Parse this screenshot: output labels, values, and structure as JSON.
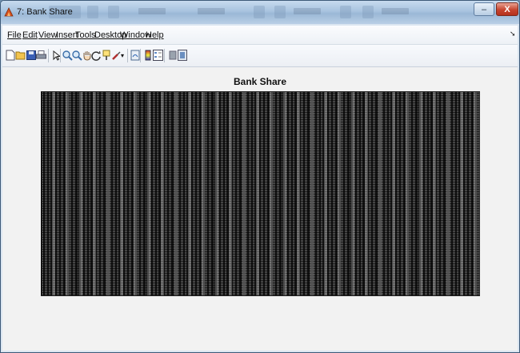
{
  "window": {
    "title": "7: Bank Share",
    "minimize_symbol": "–",
    "restore_symbol": "▫",
    "close_symbol": "X"
  },
  "menubar": {
    "items": [
      {
        "label": "File"
      },
      {
        "label": "Edit"
      },
      {
        "label": "View"
      },
      {
        "label": "Insert"
      },
      {
        "label": "Tools"
      },
      {
        "label": "Desktop"
      },
      {
        "label": "Window"
      },
      {
        "label": "Help"
      }
    ],
    "overflow_arrow": "➘"
  },
  "toolbar": {
    "tools": [
      "new-figure-icon",
      "open-file-icon",
      "save-icon",
      "print-icon",
      "edit-plot-arrow-icon",
      "zoom-in-icon",
      "zoom-out-icon",
      "pan-hand-icon",
      "rotate-3d-icon",
      "data-cursor-icon",
      "brush-icon",
      "link-plot-icon",
      "colorbar-icon",
      "legend-icon",
      "hide-plot-tools-icon",
      "show-plot-tools-icon"
    ]
  },
  "figure": {
    "axes_title": "Bank Share"
  },
  "colors": {
    "titlebar": "#a8c3df",
    "close_button": "#c7442f",
    "figure_background": "#f2f2f2",
    "image_dark": "#000000",
    "image_light": "#ffffff"
  }
}
